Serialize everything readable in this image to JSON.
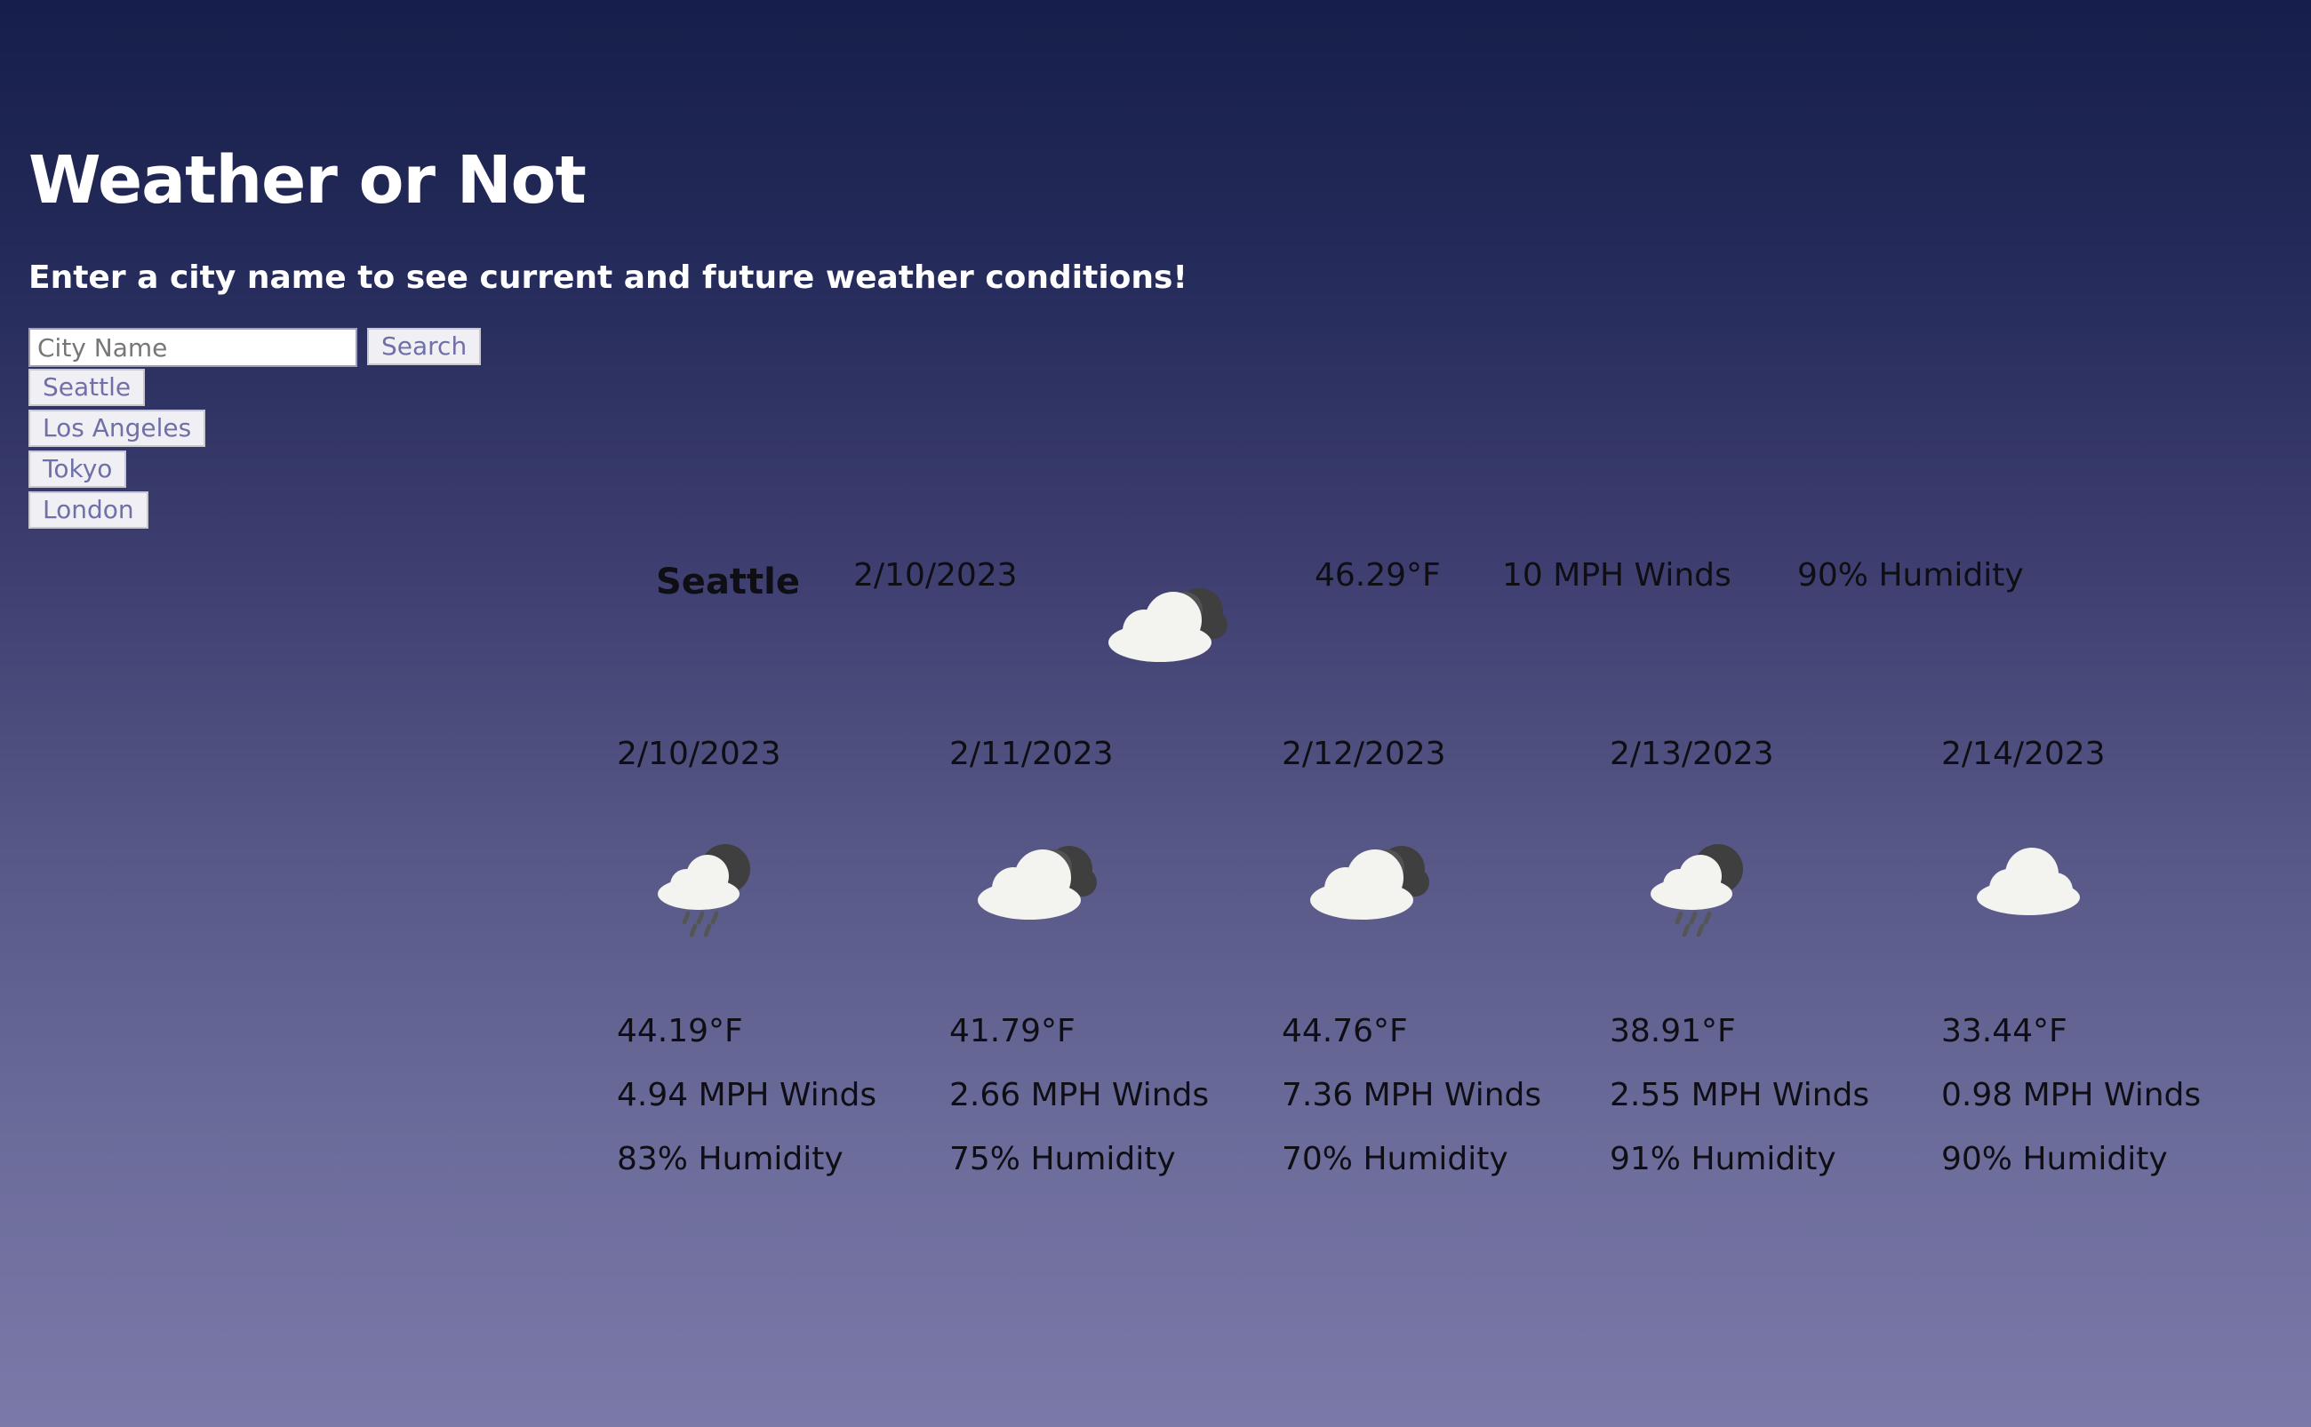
{
  "header": {
    "title": "Weather or Not",
    "subtitle": "Enter a city name to see current and future weather conditions!"
  },
  "search": {
    "placeholder": "City Name",
    "button_label": "Search"
  },
  "history": [
    "Seattle",
    "Los Angeles",
    "Tokyo",
    "London"
  ],
  "current": {
    "city": "Seattle",
    "date": "2/10/2023",
    "icon": "cloudy-night-icon",
    "temp": "46.29°F",
    "wind": "10 MPH Winds",
    "humidity": "90% Humidity"
  },
  "forecast": [
    {
      "date": "2/10/2023",
      "icon": "rain-night-icon",
      "temp": "44.19°F",
      "wind": "4.94 MPH Winds",
      "humidity": "83% Humidity"
    },
    {
      "date": "2/11/2023",
      "icon": "cloudy-night-icon",
      "temp": "41.79°F",
      "wind": "2.66 MPH Winds",
      "humidity": "75% Humidity"
    },
    {
      "date": "2/12/2023",
      "icon": "cloudy-night-icon",
      "temp": "44.76°F",
      "wind": "7.36 MPH Winds",
      "humidity": "70% Humidity"
    },
    {
      "date": "2/13/2023",
      "icon": "rain-night-icon",
      "temp": "38.91°F",
      "wind": "2.55 MPH Winds",
      "humidity": "91% Humidity"
    },
    {
      "date": "2/14/2023",
      "icon": "cloud-icon",
      "temp": "33.44°F",
      "wind": "0.98 MPH Winds",
      "humidity": "90% Humidity"
    }
  ]
}
